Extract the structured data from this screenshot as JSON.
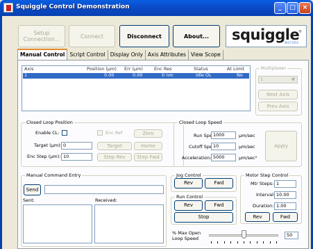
{
  "window": {
    "title": "Squiggle Control Demonstration"
  },
  "toolbar": {
    "setup_label": "Setup Connection...",
    "connect_label": "Connect",
    "disconnect_label": "Disconnect",
    "about_label": "About..."
  },
  "logo": {
    "word": "squiggle",
    "reg": "®",
    "sub": "MOTORS"
  },
  "tabs": [
    "Manual Control",
    "Script Control",
    "Display Only",
    "Axis Attributes",
    "View Scope"
  ],
  "axis_table": {
    "columns": [
      "Axis",
      "Position (µm)",
      "Err (µm)",
      "Enc Res",
      "Status",
      "At Limit"
    ],
    "rows": [
      [
        "1",
        "0.00",
        "0.00",
        "0 nm",
        "Idle OL",
        "No"
      ]
    ]
  },
  "multiplexer": {
    "label": "Multiplexer",
    "selected": "1",
    "next_label": "Next Axis",
    "prev_label": "Prev Axis"
  },
  "closed_loop_position": {
    "label": "Closed Loop Position",
    "enable_label": "Enable CL:",
    "enc_ref_label": "Enc Ref",
    "zero_label": "Zero",
    "target_label": "Target (µm):",
    "target_value": "0",
    "target_button": "Target",
    "home_button": "Home",
    "enc_step_label": "Enc Step (µm):",
    "enc_step_value": "10",
    "step_rev_button": "Step Rev",
    "step_fwd_button": "Step Fwd"
  },
  "closed_loop_speed": {
    "label": "Closed Loop Speed",
    "run_speed_label": "Run Speed:",
    "run_speed_value": "1000",
    "run_speed_unit": "µm/sec",
    "cutoff_label": "Cutoff Speed:",
    "cutoff_value": "10",
    "cutoff_unit": "µm/sec",
    "accel_label": "Acceleration:",
    "accel_value": "5000",
    "accel_unit": "µm/sec²",
    "apply_label": "Apply"
  },
  "manual_command": {
    "label": "Manual Command Entry",
    "send_label": "Send",
    "command_value": "",
    "sent_label": "Sent:",
    "received_label": "Received:"
  },
  "jog_control": {
    "label": "Jog Control",
    "rev_label": "Rev",
    "fwd_label": "Fwd"
  },
  "run_control": {
    "label": "Run Control",
    "rev_label": "Rev",
    "fwd_label": "Fwd",
    "stop_label": "Stop"
  },
  "motor_step": {
    "label": "Motor Step Control",
    "mtr_steps_label": "Mtr Steps:",
    "mtr_steps_value": "1",
    "interval_label": "Interval:",
    "interval_value": "10.00",
    "duration_label": "Duration:",
    "duration_value": "1.00",
    "rev_label": "Rev",
    "fwd_label": "Fwd"
  },
  "open_loop_speed": {
    "label_line1": "% Max Open",
    "label_line2": "Loop Speed",
    "value": "50",
    "fraction": 0.5
  }
}
